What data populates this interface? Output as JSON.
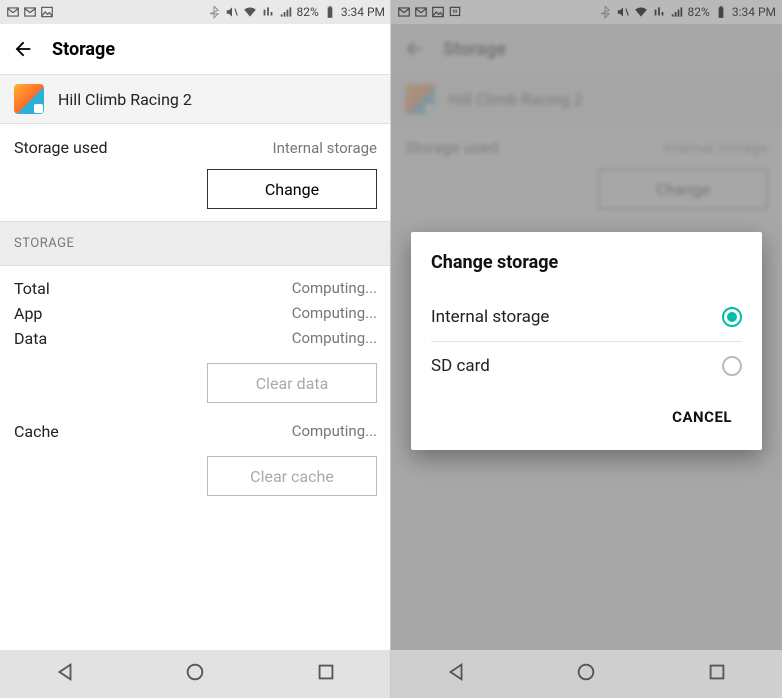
{
  "status": {
    "battery": "82%",
    "time": "3:34 PM"
  },
  "left": {
    "title": "Storage",
    "app_name": "Hill Climb Racing 2",
    "used_label": "Storage used",
    "used_value": "Internal storage",
    "change_btn": "Change",
    "section_hdr": "STORAGE",
    "rows": {
      "total_label": "Total",
      "total_value": "Computing...",
      "app_label": "App",
      "app_value": "Computing...",
      "data_label": "Data",
      "data_value": "Computing..."
    },
    "clear_data_btn": "Clear data",
    "cache_label": "Cache",
    "cache_value": "Computing...",
    "clear_cache_btn": "Clear cache"
  },
  "dialog": {
    "title": "Change storage",
    "opt1": "Internal storage",
    "opt2": "SD card",
    "cancel": "CANCEL"
  }
}
